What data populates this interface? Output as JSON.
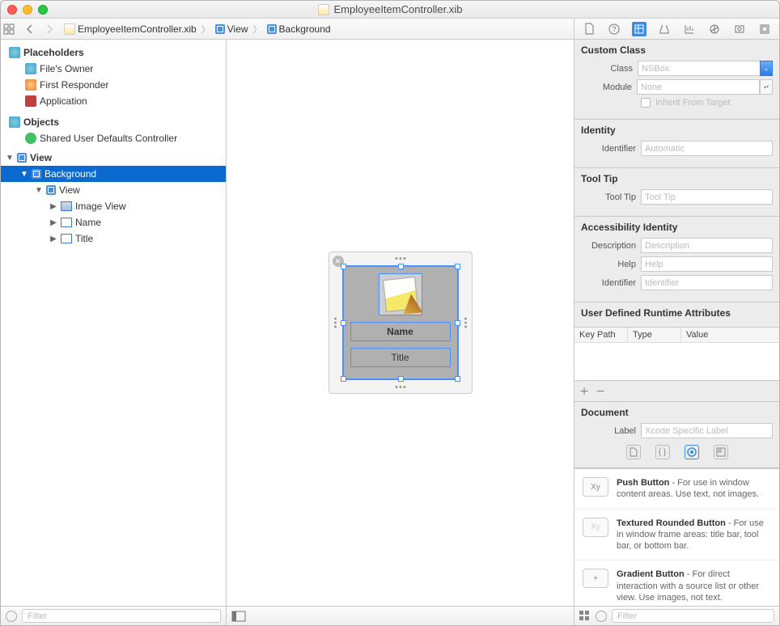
{
  "window": {
    "title": "EmployeeItemController.xib"
  },
  "jumpbar": {
    "crumbs": [
      {
        "label": "EmployeeItemController.xib",
        "type": "xib"
      },
      {
        "label": "View",
        "type": "view"
      },
      {
        "label": "Background",
        "type": "box"
      }
    ]
  },
  "outline": {
    "placeholders_header": "Placeholders",
    "files_owner": "File's Owner",
    "first_responder": "First Responder",
    "application": "Application",
    "objects_header": "Objects",
    "shared_defaults": "Shared User Defaults Controller",
    "view": "View",
    "background": "Background",
    "view2": "View",
    "image_view": "Image View",
    "name": "Name",
    "title": "Title"
  },
  "canvas": {
    "name_field": "Name",
    "title_field": "Title"
  },
  "inspector": {
    "custom_class": {
      "header": "Custom Class",
      "class_label": "Class",
      "class_value": "NSBox",
      "module_label": "Module",
      "module_value": "None",
      "inherit_label": "Inherit From Target"
    },
    "identity": {
      "header": "Identity",
      "identifier_label": "Identifier",
      "identifier_placeholder": "Automatic"
    },
    "tooltip": {
      "header": "Tool Tip",
      "label": "Tool Tip",
      "placeholder": "Tool Tip"
    },
    "accessibility": {
      "header": "Accessibility Identity",
      "description_label": "Description",
      "description_placeholder": "Description",
      "help_label": "Help",
      "help_placeholder": "Help",
      "identifier_label": "Identifier",
      "identifier_placeholder": "Identifier"
    },
    "runtime": {
      "header": "User Defined Runtime Attributes",
      "col_keypath": "Key Path",
      "col_type": "Type",
      "col_value": "Value"
    },
    "document": {
      "header": "Document",
      "label_label": "Label",
      "label_placeholder": "Xcode Specific Label"
    }
  },
  "library": {
    "items": [
      {
        "thumb": "Xy",
        "title": "Push Button",
        "desc": " - For use in window content areas. Use text, not images."
      },
      {
        "thumb": "Xy",
        "title": "Textured Rounded Button",
        "desc": " - For use in window frame areas: title bar, tool bar, or bottom bar."
      },
      {
        "thumb": "+",
        "title": "Gradient Button",
        "desc": " - For direct interaction with a source list or other view. Use images, not text."
      }
    ]
  },
  "filter_placeholder": "Filter"
}
